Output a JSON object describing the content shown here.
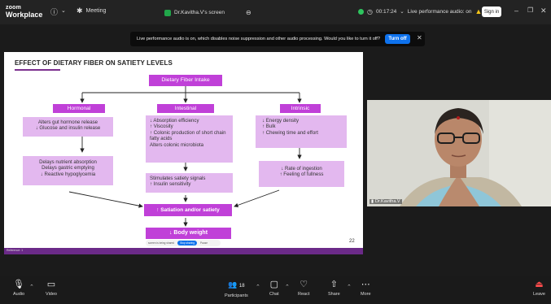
{
  "titlebar": {
    "brand_top": "zoom",
    "brand": "Workplace",
    "meeting_label": "Meeting",
    "shared_screen_tab": "Dr.Kavitha.V's screen",
    "timer": "00:17:24",
    "audio_status": "Live performance audio: on",
    "signin_label": "Sign in"
  },
  "banner": {
    "message": "Live performance audio is on, which disables noise suppression and other audio processing. Would you like to turn it off?",
    "action_label": "Turn off"
  },
  "slide": {
    "title": "EFFECT OF DIETARY FIBER ON SATIETY LEVELS",
    "top_box": "Dietary Fiber Intake",
    "columns": [
      {
        "header": "Hormonal",
        "box1": [
          "Alters gut hormone release",
          "↓ Glucose and insulin release"
        ],
        "box2": [
          "Delays nutrient absorption",
          "Delays gastric emptying",
          "↓ Reactive hypoglycemia"
        ]
      },
      {
        "header": "Intestinal",
        "box1": [
          "↓ Absorption efficiency",
          "↑ Viscosity",
          "↑ Colonic production of short chain fatty acids",
          "Alters colonic microbiota"
        ],
        "box2": [
          "Stimulates satiety signals",
          "↑ Insulin sensitivity"
        ]
      },
      {
        "header": "Intrinsic",
        "box1": [
          "↓ Energy density",
          "↑ Bulk",
          "↑ Chewing time and effort"
        ],
        "box2": [
          "↓ Rate of ingestion",
          "↑ Feeling of fullness"
        ]
      }
    ],
    "satiation_box": "↑ Satiation and/or satiety",
    "weight_box": "↓ Body weight",
    "page_number": "22",
    "reference": "Reference: 1",
    "share_pill_text": "screen is being shared",
    "share_pill_stop": "Stop sharing",
    "share_pill_pause": "Pause"
  },
  "video": {
    "participant_name": "Dr.Kavitha.V"
  },
  "toolbar": {
    "audio": "Audio",
    "video": "Video",
    "participants": "Participants",
    "participants_count": "18",
    "chat": "Chat",
    "react": "React",
    "share": "Share",
    "more": "More",
    "leave": "Leave"
  },
  "colors": {
    "accent_blue": "#0e72ed",
    "slide_header": "#c040d8",
    "slide_box": "#e3b8ef",
    "title_underline": "#7b2f8e",
    "leave_red": "#ff4d4d"
  }
}
